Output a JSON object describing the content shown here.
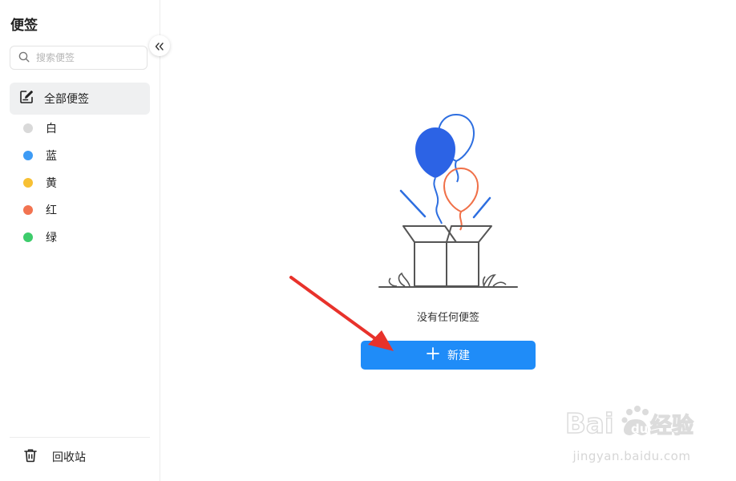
{
  "sidebar": {
    "title": "便签",
    "search": {
      "placeholder": "搜索便签",
      "value": ""
    },
    "all_notes_label": "全部便签",
    "colors": [
      {
        "label": "白",
        "color": "#d9d9d9"
      },
      {
        "label": "蓝",
        "color": "#3d9bf5"
      },
      {
        "label": "黄",
        "color": "#f7c033"
      },
      {
        "label": "红",
        "color": "#f27350"
      },
      {
        "label": "绿",
        "color": "#3dcc6b"
      }
    ],
    "trash_label": "回收站"
  },
  "main": {
    "empty_text": "没有任何便签",
    "new_button_label": "新建",
    "accent_color": "#1f8cf8"
  },
  "watermark": {
    "logo_text": "Baidu经验",
    "url": "jingyan.baidu.com"
  }
}
